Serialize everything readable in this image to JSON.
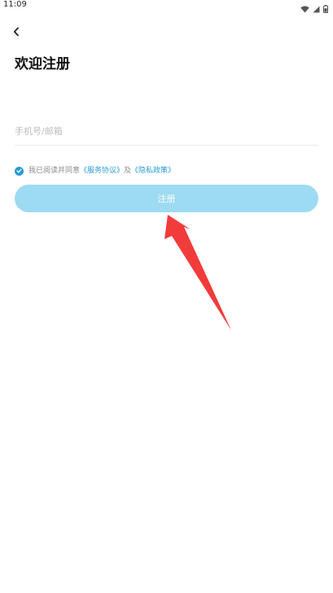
{
  "status_bar": {
    "time": "11:09",
    "icons": [
      "wifi-icon",
      "signal-icon",
      "battery-icon"
    ]
  },
  "header": {
    "back_icon": "chevron-left-icon",
    "title": "欢迎注册"
  },
  "form": {
    "account_input": {
      "value": "",
      "placeholder": "手机号/邮箱"
    },
    "agreement": {
      "checked": true,
      "prefix": "我已阅读并同意",
      "service_link": "《服务协议》",
      "conjunction": "及",
      "privacy_link": "《隐私政策》"
    },
    "register_button": "注册"
  },
  "colors": {
    "accent": "#2a9ad6",
    "button_bg": "#9ddbf3",
    "annotation_arrow": "#f23b3b"
  }
}
